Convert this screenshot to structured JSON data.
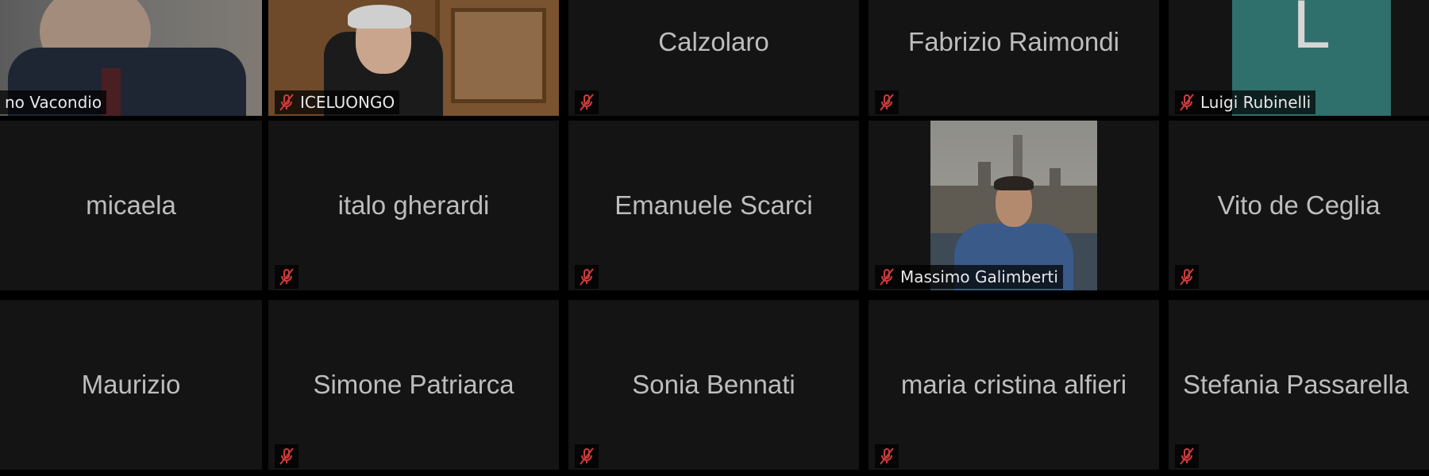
{
  "meeting": {
    "tiles": [
      {
        "id": "r1c1",
        "label": "no Vacondio",
        "muted": false,
        "active": true
      },
      {
        "id": "r1c2",
        "label": "ICELUONGO",
        "muted": true
      },
      {
        "id": "r1c3",
        "center_name": "Calzolaro",
        "muted": true
      },
      {
        "id": "r1c4",
        "center_name": "Fabrizio Raimondi",
        "muted": true
      },
      {
        "id": "r1c5",
        "label": "Luigi Rubinelli",
        "muted": true,
        "avatar_letter": "L"
      },
      {
        "id": "r2c1",
        "center_name": "micaela",
        "muted": false
      },
      {
        "id": "r2c2",
        "center_name": "italo gherardi",
        "muted": true
      },
      {
        "id": "r2c3",
        "center_name": "Emanuele Scarci",
        "muted": true
      },
      {
        "id": "r2c4",
        "label": "Massimo Galimberti",
        "muted": true
      },
      {
        "id": "r2c5",
        "center_name": "Vito de Ceglia",
        "muted": true
      },
      {
        "id": "r3c1",
        "center_name": "Maurizio",
        "muted": false
      },
      {
        "id": "r3c2",
        "center_name": "Simone Patriarca",
        "muted": true
      },
      {
        "id": "r3c3",
        "center_name": "Sonia Bennati",
        "muted": true
      },
      {
        "id": "r3c4",
        "center_name": "maria cristina alfieri",
        "muted": true
      },
      {
        "id": "r3c5",
        "center_name": "Stefania Passarella",
        "muted": true
      }
    ]
  },
  "colors": {
    "tile_bg": "#141414",
    "active_border": "#8cb43a",
    "muted_icon": "#d13b3b",
    "avatar_bg": "#2f6f6c"
  }
}
